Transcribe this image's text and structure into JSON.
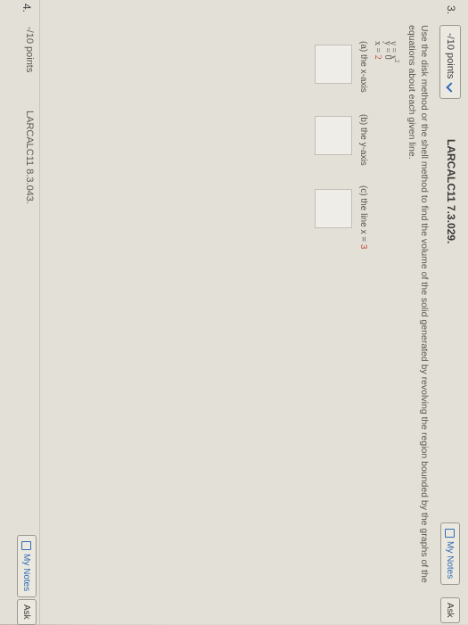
{
  "question3": {
    "number": "3.",
    "points": "-/10 points",
    "id": "LARCALC11 7.3.029.",
    "my_notes": "My Notes",
    "ask": "Ask",
    "prompt": "Use the disk method or the shell method to find the volume of the solid generated by revolving the region bounded by the graphs of the equations about each given line.",
    "equations": [
      "y = x²",
      "y = 0",
      "x = 2"
    ],
    "parts": [
      {
        "label": "(a) the x-axis"
      },
      {
        "label": "(b) the y-axis"
      },
      {
        "label": "(c) the line x = 3"
      }
    ]
  },
  "question4": {
    "number": "4.",
    "points": "-/10 points",
    "id": "LARCALC11 8.3.043.",
    "my_notes": "My Notes",
    "ask": "Ask"
  },
  "taskbar": {
    "icons": [
      "search-icon",
      "task-view-icon",
      "edge-icon",
      "file-explorer-icon",
      "store-icon",
      "mail-icon",
      "excel-icon",
      "photos-icon",
      "word-icon",
      "chrome-icon",
      "help-icon"
    ]
  }
}
